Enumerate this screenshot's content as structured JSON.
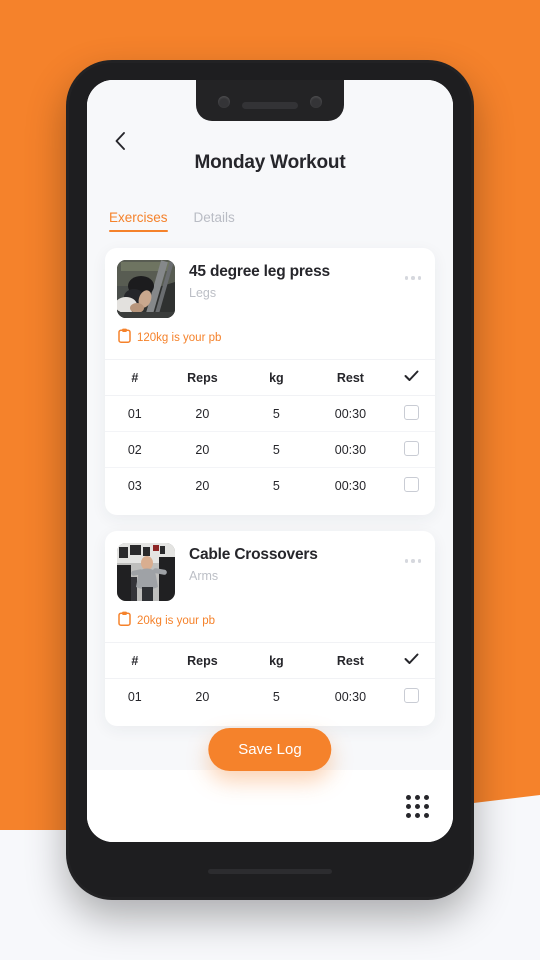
{
  "theme": {
    "accent": "#F5822B",
    "background": "#F5822B",
    "page_background": "#F7F8FB",
    "app_background": "#F7F8FA",
    "card_background": "#FFFFFF",
    "text_primary": "#26262B",
    "text_muted": "#BCBFC6"
  },
  "header": {
    "back_icon": "chevron-left-icon",
    "title": "Monday Workout"
  },
  "tabs": [
    {
      "label": "Exercises",
      "active": true
    },
    {
      "label": "Details",
      "active": false
    }
  ],
  "table_headers": {
    "number": "#",
    "reps": "Reps",
    "kg": "kg",
    "rest": "Rest",
    "done": "check-icon"
  },
  "exercises": [
    {
      "name": "45 degree leg press",
      "muscle_group": "Legs",
      "pb_icon": "clipboard-icon",
      "pb_text": "120kg is your pb",
      "menu_icon": "more-horizontal-icon",
      "thumbnail": "leg-press-photo",
      "sets": [
        {
          "number": "01",
          "reps": "20",
          "kg": "5",
          "rest": "00:30",
          "done": false
        },
        {
          "number": "02",
          "reps": "20",
          "kg": "5",
          "rest": "00:30",
          "done": false
        },
        {
          "number": "03",
          "reps": "20",
          "kg": "5",
          "rest": "00:30",
          "done": false
        }
      ]
    },
    {
      "name": "Cable Crossovers",
      "muscle_group": "Arms",
      "pb_icon": "clipboard-icon",
      "pb_text": "20kg is your pb",
      "menu_icon": "more-horizontal-icon",
      "thumbnail": "cable-crossover-photo",
      "sets": [
        {
          "number": "01",
          "reps": "20",
          "kg": "5",
          "rest": "00:30",
          "done": false
        }
      ]
    }
  ],
  "save_button": {
    "label": "Save Log"
  },
  "bottom_bar": {
    "grid_icon": "apps-grid-icon"
  }
}
